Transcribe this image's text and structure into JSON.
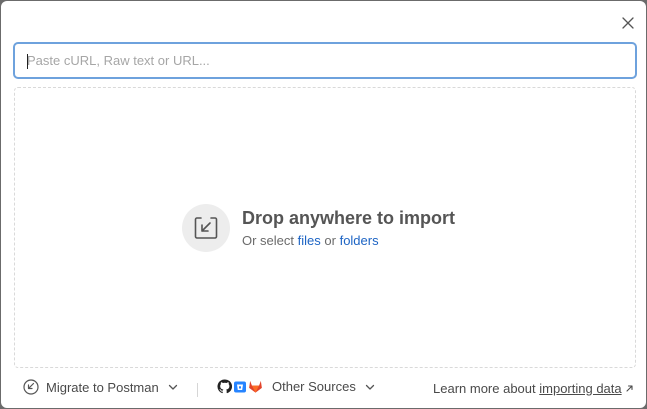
{
  "search": {
    "placeholder": "Paste cURL, Raw text or URL..."
  },
  "dropzone": {
    "title": "Drop anywhere to import",
    "subtitle_prefix": "Or select",
    "files_link": "files",
    "or_text": "or",
    "folders_link": "folders"
  },
  "footer": {
    "migrate_label": "Migrate to Postman",
    "sources_label": "Other Sources",
    "learn_prefix": "Learn more about",
    "learn_link": "importing data"
  },
  "icons": {
    "close": "close-icon",
    "import": "import-tray-icon",
    "migrate": "migrate-icon",
    "github": "github-icon",
    "bitbucket": "bitbucket-icon",
    "gitlab": "gitlab-icon",
    "external": "external-link-icon"
  },
  "colors": {
    "accent_border": "#6ea2dd",
    "link": "#1d64c4",
    "gitlab": "#e2432a",
    "bitbucket": "#2684ff"
  }
}
